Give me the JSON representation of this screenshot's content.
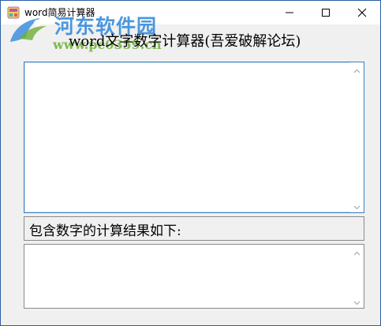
{
  "window": {
    "title": "word简易计算器",
    "buttons": {
      "minimize": "minimize-icon",
      "maximize": "maximize-icon",
      "close": "close-icon"
    }
  },
  "watermark": {
    "site_name": "河东软件园",
    "url": "www.pc0359.cn"
  },
  "main": {
    "heading": "word文字数字计算器(吾爱破解论坛)",
    "input_text": "",
    "result_label": "包含数字的计算结果如下:",
    "result_text": ""
  },
  "colors": {
    "titlebar": "#ffffff",
    "client_bg": "#f0f0f0",
    "focus_border": "#3a7fc0",
    "watermark_blue": "#3d8fdc",
    "watermark_green": "#6fae36"
  }
}
